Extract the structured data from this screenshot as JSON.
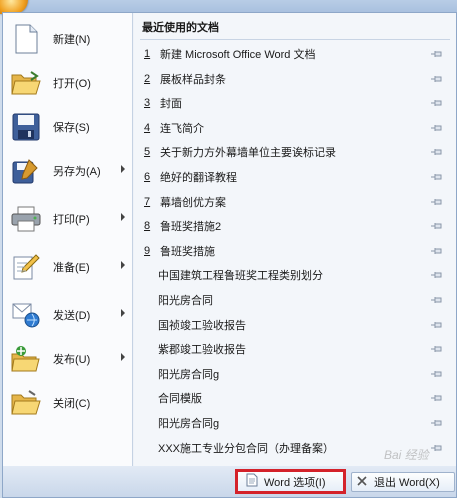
{
  "commands": [
    {
      "id": "new",
      "label": "新建(N)",
      "icon": "new-document-icon",
      "submenu": false
    },
    {
      "id": "open",
      "label": "打开(O)",
      "icon": "open-folder-icon",
      "submenu": false
    },
    {
      "id": "save",
      "label": "保存(S)",
      "icon": "save-disk-icon",
      "submenu": false
    },
    {
      "id": "save-as",
      "label": "另存为(A)",
      "icon": "save-as-icon",
      "submenu": true
    },
    {
      "id": "print",
      "label": "打印(P)",
      "icon": "printer-icon",
      "submenu": true
    },
    {
      "id": "prepare",
      "label": "准备(E)",
      "icon": "prepare-pencil-icon",
      "submenu": true
    },
    {
      "id": "send",
      "label": "发送(D)",
      "icon": "send-icon",
      "submenu": true
    },
    {
      "id": "publish",
      "label": "发布(U)",
      "icon": "publish-folder-icon",
      "submenu": true
    },
    {
      "id": "close",
      "label": "关闭(C)",
      "icon": "close-folder-icon",
      "submenu": false
    }
  ],
  "recent": {
    "title": "最近使用的文档",
    "items": [
      {
        "num": "1",
        "name": "新建 Microsoft Office Word 文档"
      },
      {
        "num": "2",
        "name": "展板样品封条"
      },
      {
        "num": "3",
        "name": "封面"
      },
      {
        "num": "4",
        "name": "连飞简介"
      },
      {
        "num": "5",
        "name": "关于新力方外幕墙单位主要诶标记录"
      },
      {
        "num": "6",
        "name": "绝好的翻译教程"
      },
      {
        "num": "7",
        "name": "幕墙创优方案"
      },
      {
        "num": "8",
        "name": "鲁班奖措施2"
      },
      {
        "num": "9",
        "name": "鲁班奖措施"
      },
      {
        "num": "",
        "name": "中国建筑工程鲁班奖工程类别划分"
      },
      {
        "num": "",
        "name": "阳光房合同"
      },
      {
        "num": "",
        "name": "国祯竣工验收报告"
      },
      {
        "num": "",
        "name": "紫郡竣工验收报告"
      },
      {
        "num": "",
        "name": "阳光房合同g"
      },
      {
        "num": "",
        "name": "合同模版"
      },
      {
        "num": "",
        "name": "阳光房合同g"
      },
      {
        "num": "",
        "name": "XXX施工专业分包合同（办理备案）"
      }
    ]
  },
  "footer": {
    "options_label": "Word 选项(I)",
    "exit_label": "退出 Word(X)"
  },
  "watermark": "Bai 经验",
  "colors": {
    "highlight_border": "#d4222a",
    "menu_border": "#8ea7c8"
  }
}
